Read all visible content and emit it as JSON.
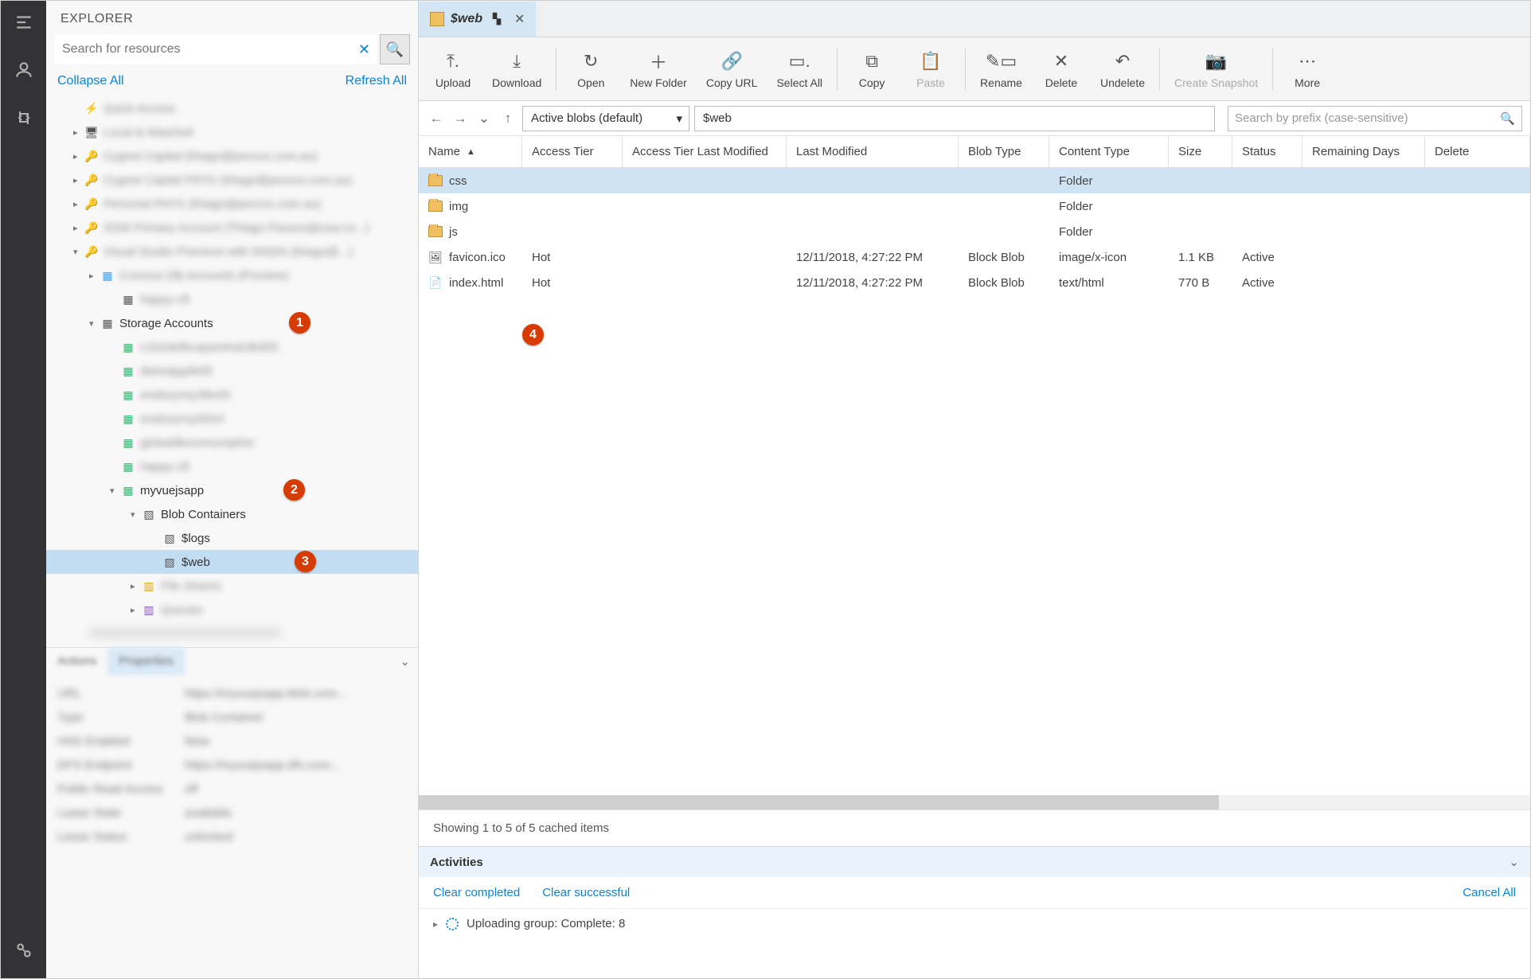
{
  "explorer": {
    "title": "EXPLORER",
    "search_placeholder": "Search for resources",
    "collapse_all": "Collapse All",
    "refresh_all": "Refresh All"
  },
  "tree": {
    "storage_accounts": "Storage Accounts",
    "myvuejsapp": "myvuejsapp",
    "blob_containers": "Blob Containers",
    "logs": "$logs",
    "web": "$web"
  },
  "badges": {
    "b1": "1",
    "b2": "2",
    "b3": "3",
    "b4": "4"
  },
  "tab": {
    "title": "$web"
  },
  "toolbar": {
    "upload": "Upload",
    "download": "Download",
    "open": "Open",
    "new_folder": "New Folder",
    "copy_url": "Copy URL",
    "select_all": "Select All",
    "copy": "Copy",
    "paste": "Paste",
    "rename": "Rename",
    "delete": "Delete",
    "undelete": "Undelete",
    "create_snapshot": "Create Snapshot",
    "more": "More"
  },
  "pathbar": {
    "filter": "Active blobs (default)",
    "breadcrumb": "$web",
    "prefix_placeholder": "Search by prefix (case-sensitive)"
  },
  "columns": {
    "name": "Name",
    "access_tier": "Access Tier",
    "access_tier_last_modified": "Access Tier Last Modified",
    "last_modified": "Last Modified",
    "blob_type": "Blob Type",
    "content_type": "Content Type",
    "size": "Size",
    "status": "Status",
    "remaining_days": "Remaining Days",
    "deleted": "Delete"
  },
  "rows": [
    {
      "name": "css",
      "content_type": "Folder",
      "is_folder": true
    },
    {
      "name": "img",
      "content_type": "Folder",
      "is_folder": true
    },
    {
      "name": "js",
      "content_type": "Folder",
      "is_folder": true
    },
    {
      "name": "favicon.ico",
      "access_tier": "Hot",
      "last_modified": "12/11/2018, 4:27:22 PM",
      "blob_type": "Block Blob",
      "content_type": "image/x-icon",
      "size": "1.1 KB",
      "status": "Active",
      "is_folder": false
    },
    {
      "name": "index.html",
      "access_tier": "Hot",
      "last_modified": "12/11/2018, 4:27:22 PM",
      "blob_type": "Block Blob",
      "content_type": "text/html",
      "size": "770 B",
      "status": "Active",
      "is_folder": false
    }
  ],
  "footer": {
    "showing": "Showing 1 to 5 of 5 cached items"
  },
  "activities": {
    "title": "Activities",
    "clear_completed": "Clear completed",
    "clear_successful": "Clear successful",
    "cancel_all": "Cancel All",
    "item": "Uploading group: Complete: 8"
  },
  "properties": {
    "tab_actions": "Actions",
    "tab_properties": "Properties",
    "rows": [
      {
        "k": "URL",
        "v": "https://myvuejsapp.blob.core..."
      },
      {
        "k": "Type",
        "v": "Blob Container"
      },
      {
        "k": "HNS Enabled",
        "v": "false"
      },
      {
        "k": "DFS Endpoint",
        "v": "https://myvuejsapp.dfs.core..."
      },
      {
        "k": "Public Read Access",
        "v": "off"
      },
      {
        "k": "Lease State",
        "v": "available"
      },
      {
        "k": "Lease Status",
        "v": "unlocked"
      }
    ]
  }
}
